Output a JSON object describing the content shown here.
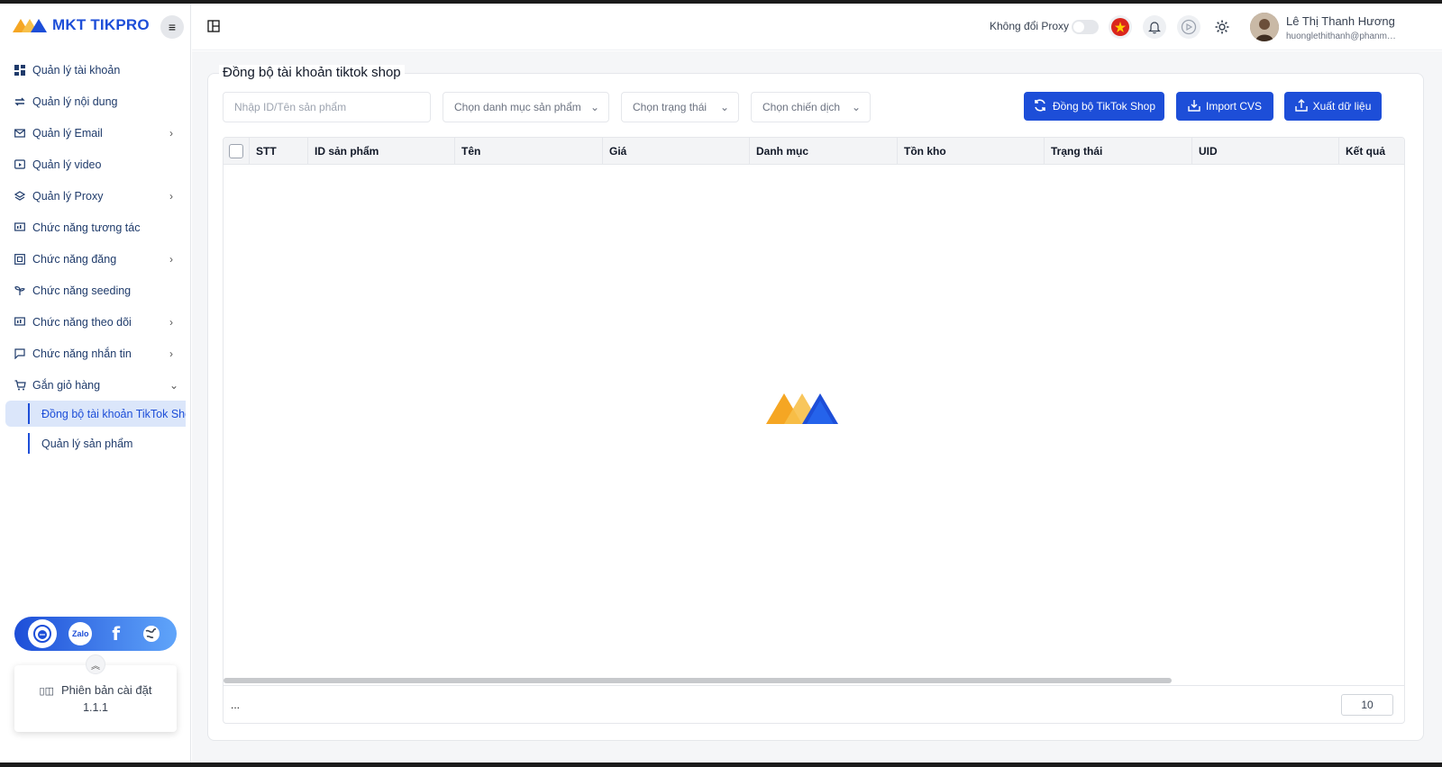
{
  "brand": {
    "name": "MKT TIKPRO"
  },
  "sidebar": {
    "items": [
      {
        "label": "Quản lý tài khoản",
        "icon": "dashboard-icon",
        "has_children": false
      },
      {
        "label": "Quản lý nội dung",
        "icon": "swap-icon",
        "has_children": false
      },
      {
        "label": "Quản lý Email",
        "icon": "mail-icon",
        "has_children": true
      },
      {
        "label": "Quản lý video",
        "icon": "video-icon",
        "has_children": false
      },
      {
        "label": "Quản lý Proxy",
        "icon": "layers-icon",
        "has_children": true
      },
      {
        "label": "Chức năng tương tác",
        "icon": "interact-icon",
        "has_children": false
      },
      {
        "label": "Chức năng đăng",
        "icon": "post-icon",
        "has_children": true
      },
      {
        "label": "Chức năng seeding",
        "icon": "seeding-icon",
        "has_children": false
      },
      {
        "label": "Chức năng theo dõi",
        "icon": "follow-icon",
        "has_children": true
      },
      {
        "label": "Chức năng nhắn tin",
        "icon": "chat-icon",
        "has_children": true
      },
      {
        "label": "Gắn giỏ hàng",
        "icon": "cart-icon",
        "has_children": true,
        "expanded": true
      }
    ],
    "sub_items": [
      {
        "label": "Đồng bộ tài khoản TikTok Shop",
        "active": true
      },
      {
        "label": "Quản lý sản phẩm",
        "active": false
      }
    ],
    "social": [
      "support-icon",
      "zalo-icon",
      "facebook-icon",
      "globe-icon"
    ],
    "social_zalo_text": "Zalo",
    "version_label": "Phiên bản cài đặt",
    "version_number": "1.1.1"
  },
  "topbar": {
    "proxy_label": "Không đổi Proxy",
    "proxy_enabled": false,
    "user_name": "Lê Thị Thanh Hương",
    "user_email": "huonglethithanh@phanmemmkt.vn"
  },
  "page": {
    "title": "Đồng bộ tài khoản tiktok shop",
    "search_placeholder": "Nhập ID/Tên sản phẩm",
    "category_select": "Chọn danh mục sản phẩm",
    "status_select": "Chọn trạng thái",
    "campaign_select": "Chọn chiến dịch",
    "sync_button": "Đồng bộ TikTok Shop",
    "import_button": "Import CVS",
    "export_button": "Xuất dữ liệu"
  },
  "table": {
    "columns": [
      "STT",
      "ID sản phẩm",
      "Tên",
      "Giá",
      "Danh mục",
      "Tồn kho",
      "Trạng thái",
      "UID",
      "Kết quả"
    ],
    "rows": [],
    "footer_ellipsis": "...",
    "page_size": "10"
  },
  "colors": {
    "primary": "#1d4ed8",
    "active_bg": "#dbe6fa",
    "logo_orange": "#f5a623",
    "logo_blue": "#1d4ed8"
  }
}
